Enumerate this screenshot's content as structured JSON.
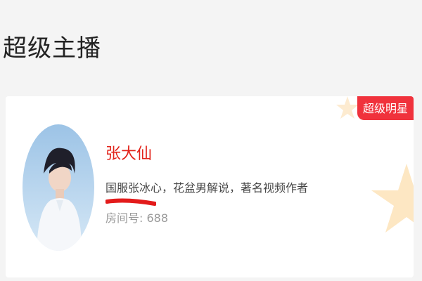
{
  "section": {
    "title": "超级主播"
  },
  "card": {
    "badge": "超级明星",
    "name": "张大仙",
    "description": "国服张冰心，花盆男解说，著名视频作者",
    "room_label": "房间号:",
    "room_number": "688"
  },
  "colors": {
    "accent": "#e2231a",
    "badge_bg": "#f0323c",
    "star": "#fde7c3",
    "avatar_bg": "#b9d6ee"
  }
}
